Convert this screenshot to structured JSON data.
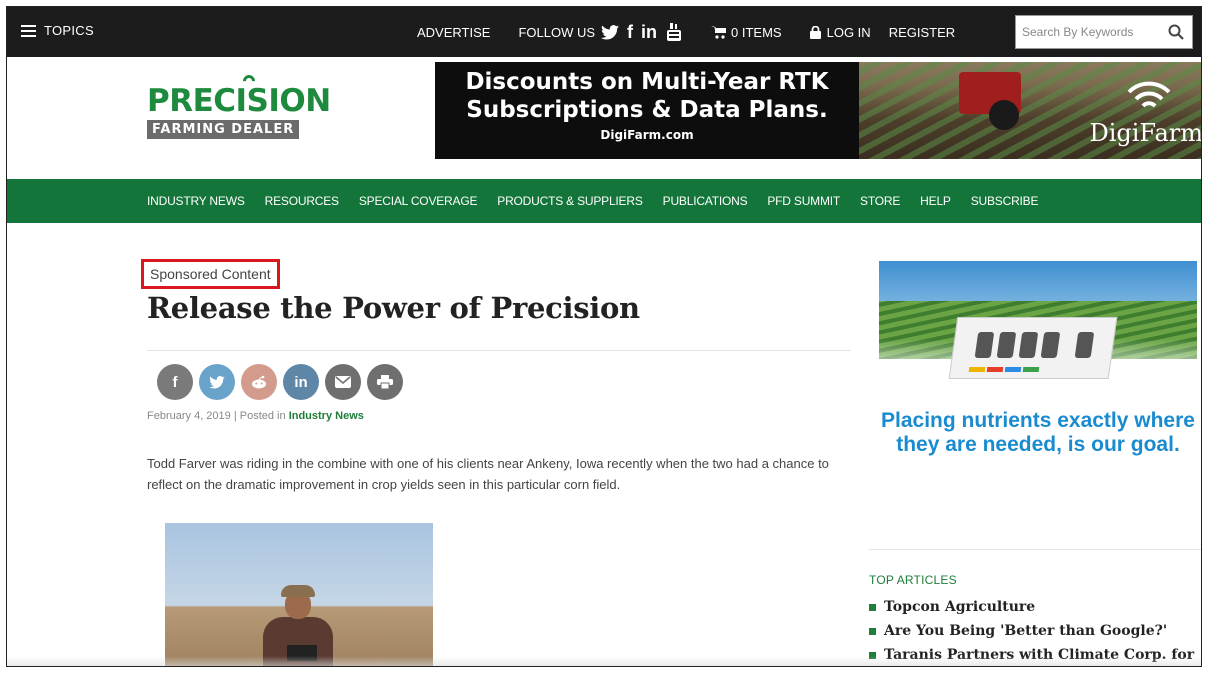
{
  "topbar": {
    "topics_label": "TOPICS",
    "advertise_label": "ADVERTISE",
    "follow_label": "FOLLOW US",
    "social": {
      "twitter": "🐦",
      "facebook": "f",
      "linkedin": "in",
      "youtube": "You Tube"
    },
    "cart_label": "0 ITEMS",
    "login_label": "LOG IN",
    "register_label": "REGISTER",
    "search_placeholder": "Search By Keywords"
  },
  "logo": {
    "word": "PRECISION",
    "sub": "FARMING DEALER"
  },
  "banner": {
    "line1": "Discounts on Multi-Year RTK",
    "line2": "Subscriptions & Data Plans.",
    "url": "DigiFarm.com",
    "brand": "DigiFarm"
  },
  "nav": [
    "INDUSTRY NEWS",
    "RESOURCES",
    "SPECIAL COVERAGE",
    "PRODUCTS & SUPPLIERS",
    "PUBLICATIONS",
    "PFD SUMMIT",
    "STORE",
    "HELP",
    "SUBSCRIBE"
  ],
  "article": {
    "sponsored_label": "Sponsored Content",
    "title": "Release the Power of Precision",
    "date": "February 4, 2019",
    "posted_in": "| Posted in ",
    "category": "Industry News",
    "body": "Todd Farver was riding in the combine with one of his clients near Ankeny, Iowa recently when the two had a chance to reflect on the dramatic improvement in crop yields seen in this particular corn field."
  },
  "share_buttons": [
    {
      "name": "facebook-share",
      "glyph": "f",
      "color": "#7a7a7a"
    },
    {
      "name": "twitter-share",
      "glyph": "t",
      "color": "#6aa3c9"
    },
    {
      "name": "reddit-share",
      "glyph": "r",
      "color": "#d39b8b"
    },
    {
      "name": "linkedin-share",
      "glyph": "in",
      "color": "#5e86a7"
    },
    {
      "name": "email-share",
      "glyph": "✉",
      "color": "#6f6f6f"
    },
    {
      "name": "print-share",
      "glyph": "⎙",
      "color": "#6f6f6f"
    }
  ],
  "sidebar": {
    "ad_text": "Placing nutrients exactly where they are needed, is our goal.",
    "top_articles_heading": "TOP ARTICLES",
    "top_articles": [
      "Topcon Agriculture",
      "Are You Being 'Better than Google?'",
      "Taranis Partners with Climate Corp. for"
    ]
  },
  "colors": {
    "brand_green": "#13753a",
    "highlight_red": "#d9171c",
    "ad_blue": "#1b8bd0"
  }
}
